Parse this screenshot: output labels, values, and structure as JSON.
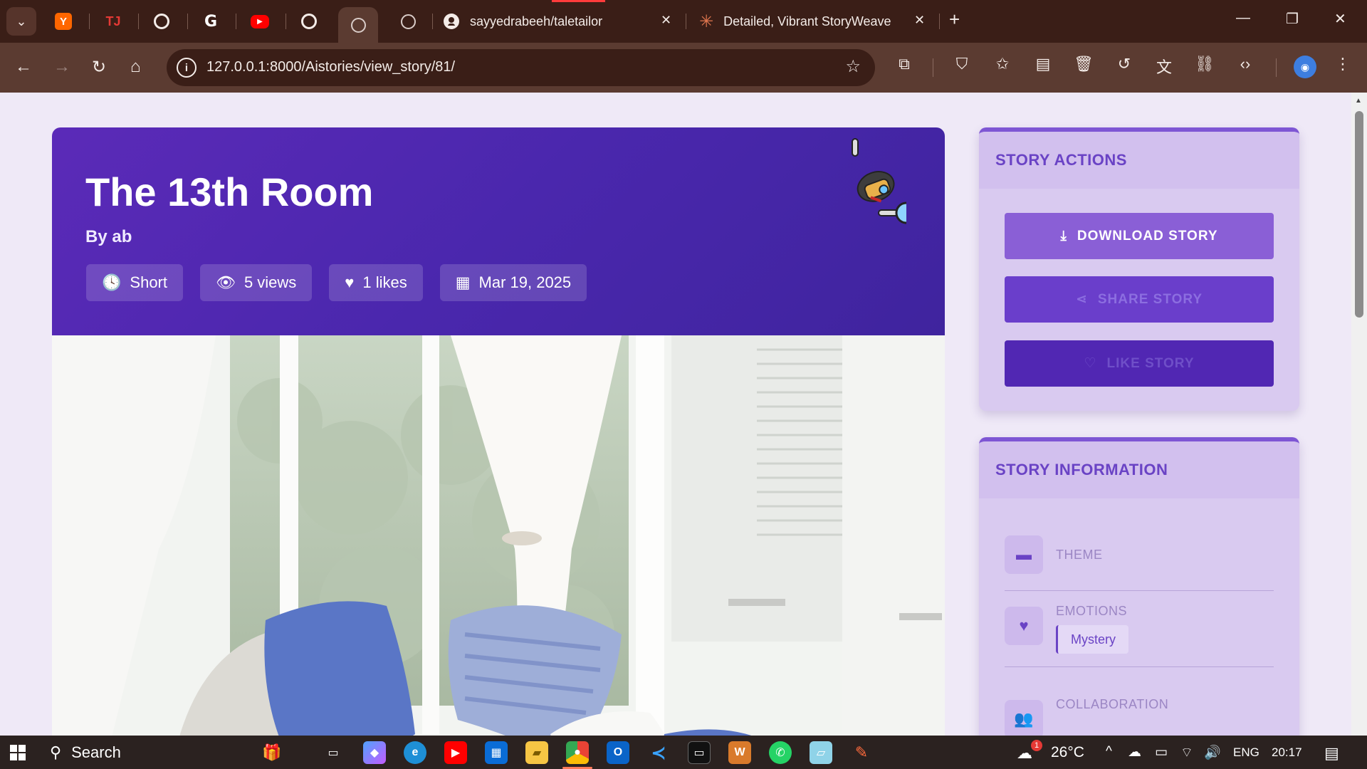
{
  "browser": {
    "tabs": [
      {
        "icon": "y-combinator-icon",
        "glyph": "Y"
      },
      {
        "icon": "tj-icon",
        "glyph": "TJ"
      },
      {
        "icon": "openai-icon",
        "glyph": ""
      },
      {
        "icon": "google-icon",
        "glyph": "G"
      },
      {
        "icon": "youtube-icon",
        "glyph": "▶"
      },
      {
        "icon": "openai-icon",
        "glyph": ""
      },
      {
        "icon": "globe-icon",
        "glyph": ""
      },
      {
        "icon": "globe-icon",
        "glyph": ""
      }
    ],
    "github_tab": {
      "label": "sayyedrabeeh/taletailor",
      "icon": "github-icon"
    },
    "claude_tab": {
      "label": "Detailed, Vibrant StoryWeave R",
      "icon": "claude-icon"
    },
    "url": "127.0.0.1:8000/Aistories/view_story/81/"
  },
  "story": {
    "title": "The 13th Room",
    "author": "By ab",
    "meta": {
      "length": "Short",
      "views": "5 views",
      "likes": "1 likes",
      "date": "Mar 19, 2025"
    }
  },
  "actions": {
    "heading": "STORY ACTIONS",
    "download": "DOWNLOAD STORY",
    "share": "SHARE STORY",
    "like": "LIKE STORY"
  },
  "information": {
    "heading": "STORY INFORMATION",
    "theme_label": "THEME",
    "emotions_label": "EMOTIONS",
    "emotion_tag": "Mystery",
    "collaboration_label": "COLLABORATION"
  },
  "taskbar": {
    "search": "Search",
    "weather_temp": "26°C",
    "weather_badge": "1",
    "language": "ENG",
    "time": "20:17"
  },
  "colors": {
    "header_purple": "#4a27ad",
    "panel_lavender": "#d9caf0",
    "accent": "#6a43c5",
    "chrome_brown": "#3a1e17"
  }
}
